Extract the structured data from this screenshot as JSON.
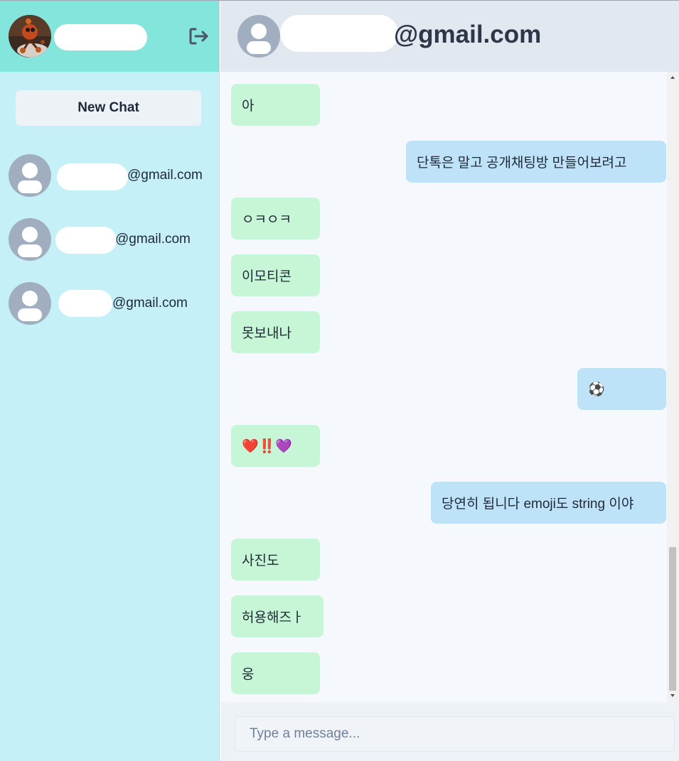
{
  "sidebar": {
    "new_chat_label": "New Chat",
    "contacts": [
      {
        "email": "@gmail.com"
      },
      {
        "email": "@gmail.com"
      },
      {
        "email": "@gmail.com"
      }
    ]
  },
  "chat": {
    "title": "@gmail.com",
    "messages": [
      {
        "from": "them",
        "text": "아"
      },
      {
        "from": "me",
        "text": "단톡은 말고 공개채팅방 만들어보려고"
      },
      {
        "from": "them",
        "text": "ㅇㅋㅇㅋ"
      },
      {
        "from": "them",
        "text": "이모티콘"
      },
      {
        "from": "them",
        "text": "못보내나"
      },
      {
        "from": "me",
        "text": "⚽"
      },
      {
        "from": "them",
        "text": "❤️‼️💜"
      },
      {
        "from": "me",
        "text": "당연히 됩니다 emoji도 string 이야"
      },
      {
        "from": "them",
        "text": "사진도"
      },
      {
        "from": "them",
        "text": "허용해즈ㅏ"
      },
      {
        "from": "them",
        "text": "웅"
      }
    ]
  },
  "composer": {
    "placeholder": "Type a message..."
  },
  "colors": {
    "sidebar_bg": "#c5f0f8",
    "sidebar_header_bg": "#84e5dc",
    "chat_header_bg": "#e2e8f0",
    "incoming_bubble": "#c6f6d5",
    "outgoing_bubble": "#bee3f8"
  },
  "icons": {
    "logout": "logout-icon",
    "default_avatar": "user-avatar-icon",
    "soccer_ball": "soccer-ball-emoji"
  }
}
